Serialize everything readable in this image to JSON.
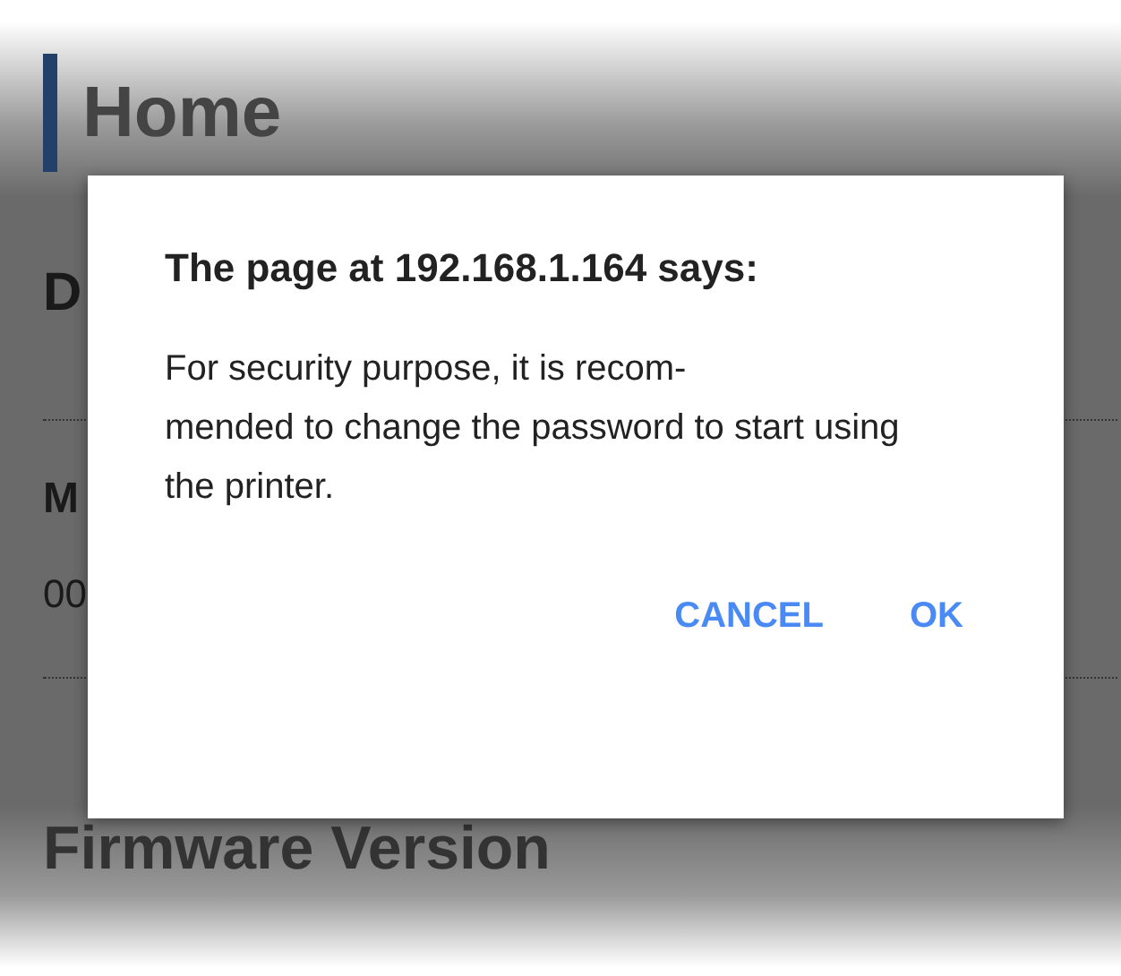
{
  "page": {
    "title": "Home",
    "fields": [
      {
        "kind": "heading",
        "text": "D"
      },
      {
        "kind": "divider"
      },
      {
        "kind": "label",
        "text": "M"
      },
      {
        "kind": "value",
        "text": "00"
      },
      {
        "kind": "divider"
      },
      {
        "kind": "heading",
        "text": "Firmware Version"
      }
    ]
  },
  "dialog": {
    "title": "The page at 192.168.1.164 says:",
    "message": "For security purpose, it is recom-mended to change the password to start using the printer.",
    "buttons": [
      "CANCEL",
      "OK"
    ]
  }
}
